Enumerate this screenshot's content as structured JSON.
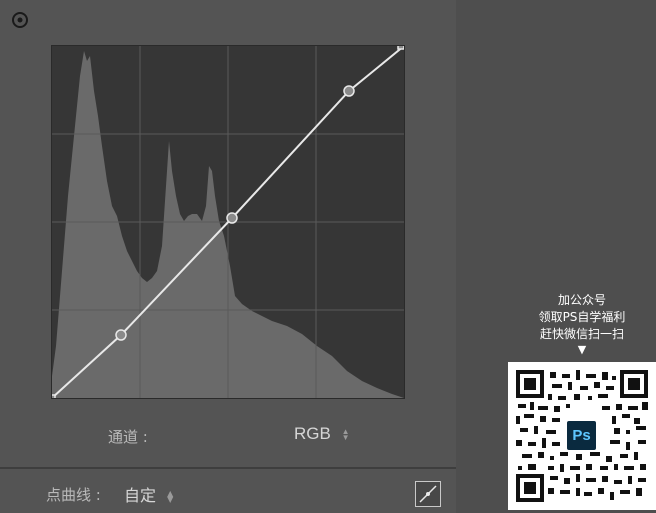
{
  "panel": {
    "channel_label": "通道 :",
    "channel_value": "RGB",
    "point_curve_label": "点曲线 :",
    "point_curve_value": "自定"
  },
  "curve": {
    "points": [
      [
        0,
        0
      ],
      [
        0.196,
        0.18
      ],
      [
        0.51,
        0.51
      ],
      [
        0.845,
        0.87
      ],
      [
        1,
        1
      ]
    ]
  },
  "promo": {
    "line1": "加公众号",
    "line2": "领取PS自学福利",
    "line3": "赶快微信扫一扫",
    "arrow": "▼",
    "badge": "Ps"
  },
  "icons": {
    "target": "target-adjust-icon",
    "edit": "edit-point-curve-icon",
    "stepper": "up-down-stepper-icon"
  },
  "colors": {
    "panel_bg": "#545454",
    "graph_bg": "#363636",
    "histogram": "#6a6a6a",
    "curve_line": "#e8e8e8"
  }
}
